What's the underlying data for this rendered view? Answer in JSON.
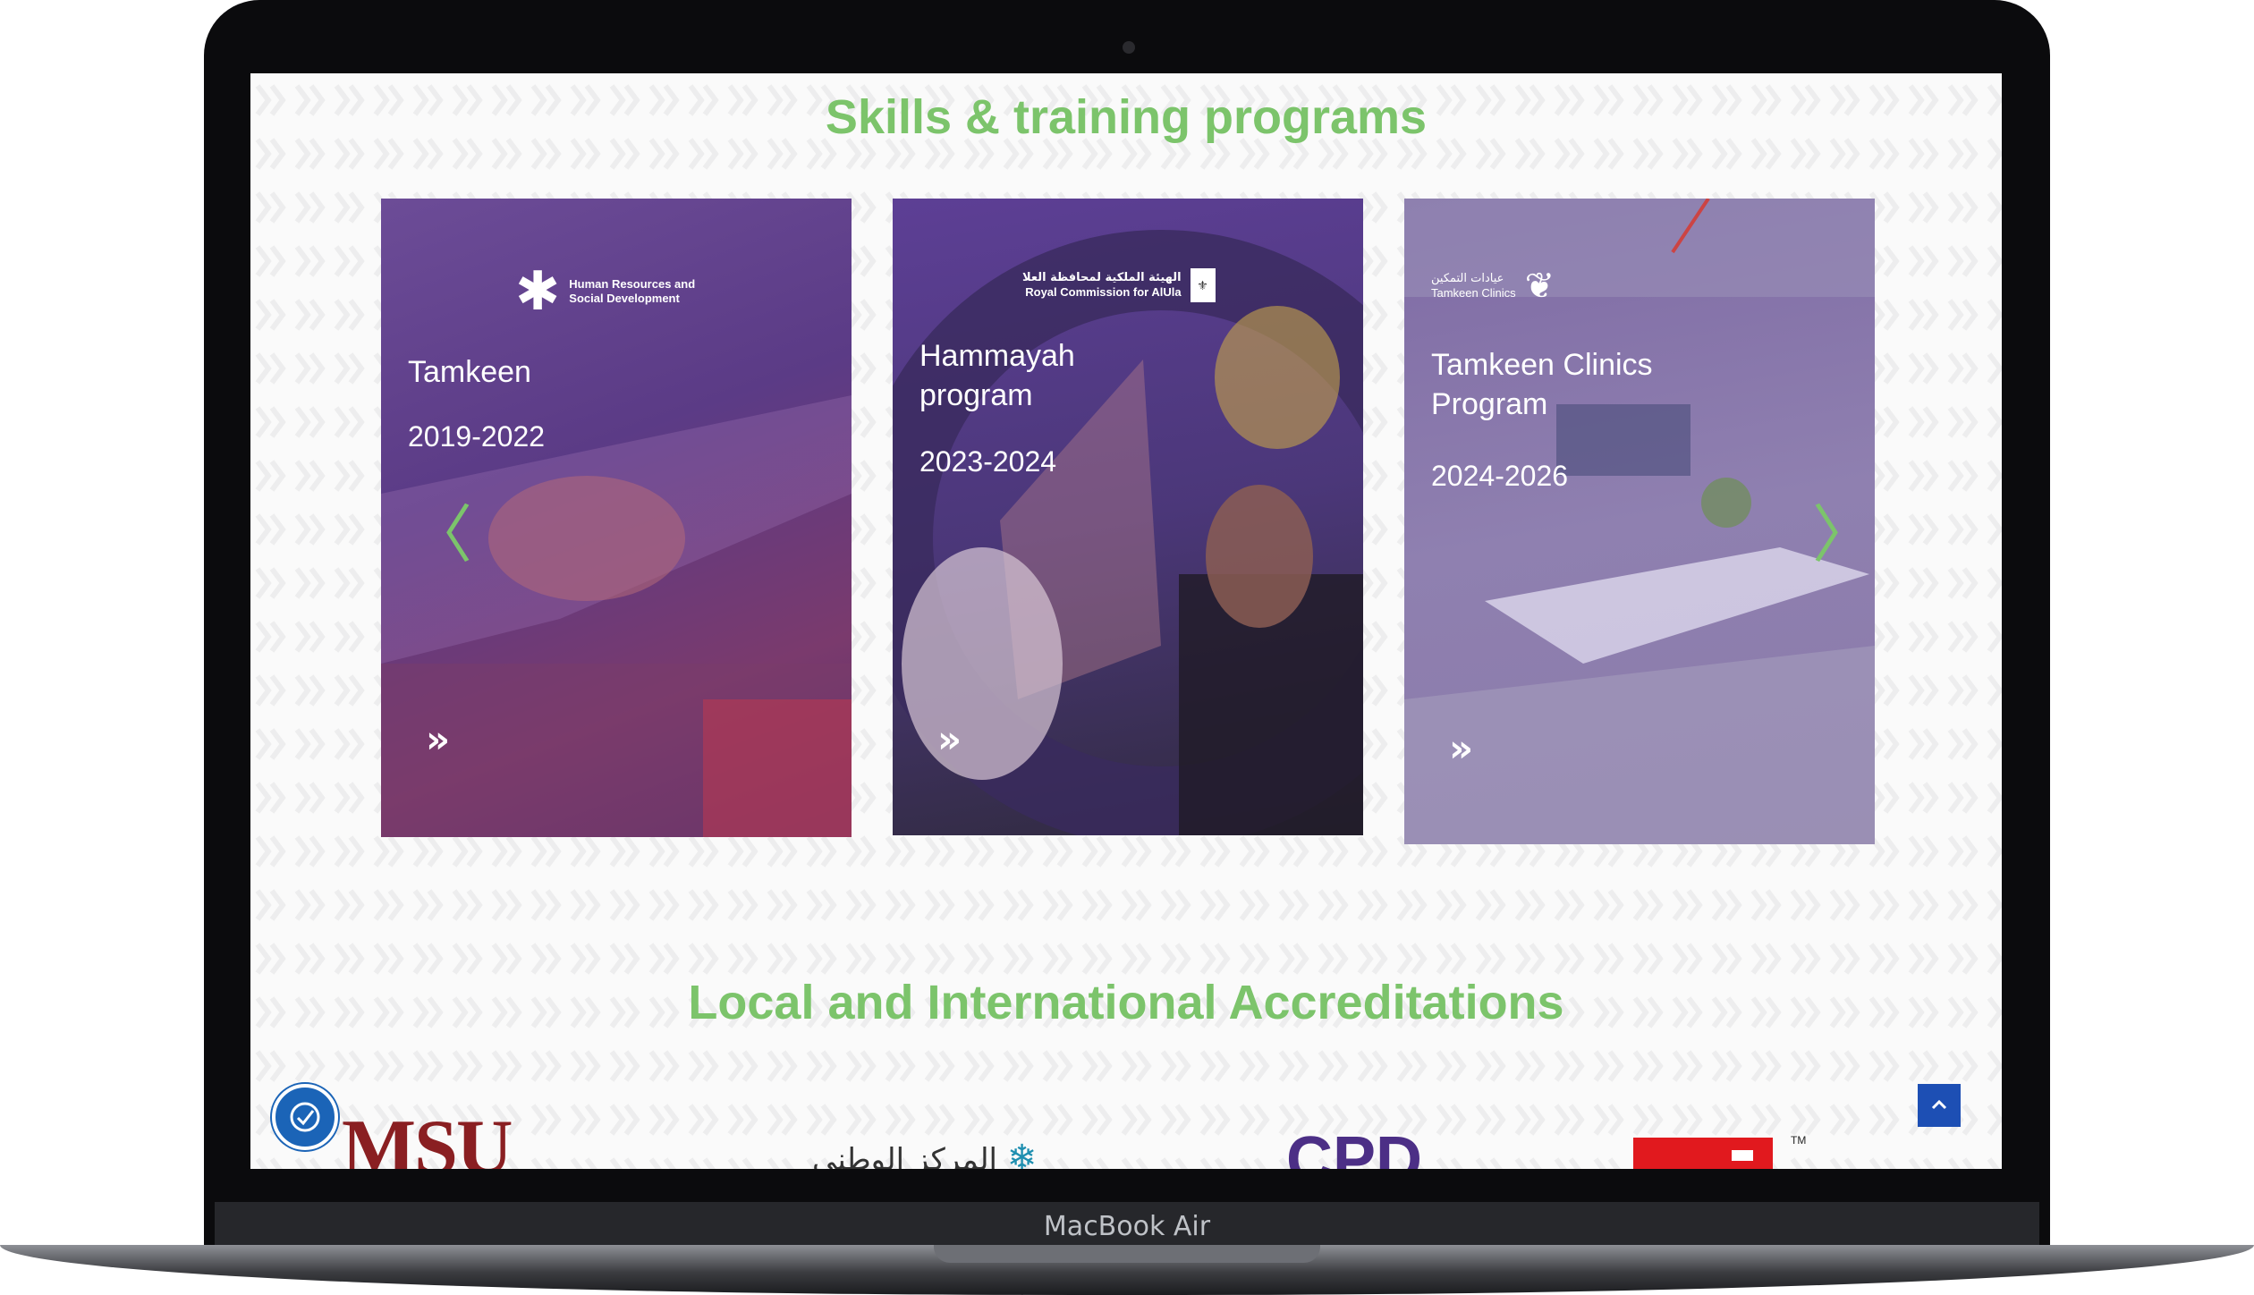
{
  "device": {
    "model_label": "MacBook Air"
  },
  "sections": {
    "skills_title": "Skills & training programs",
    "accreditations_title": "Local and International Accreditations"
  },
  "cards": [
    {
      "title_line1": "Tamkeen",
      "title_line2": "",
      "years": "2019-2022",
      "logo_text": "Human Resources and Social Development"
    },
    {
      "title_line1": "Hammayah",
      "title_line2": "program",
      "years": "2023-2024",
      "logo_text_ar": "الهيئة الملكية لمحافظة العلا",
      "logo_text": "Royal Commission for AlUla"
    },
    {
      "title_line1": "Tamkeen Clinics",
      "title_line2": "Program",
      "years": "2024-2026",
      "logo_text_ar": "عيادات التمكين",
      "logo_text": "Tamkeen Clinics"
    }
  ],
  "card_arrow": "»",
  "carousel": {
    "prev": "〈",
    "next": "〉"
  },
  "accreditations": {
    "msu": "MSU",
    "national_center": "المركز الوطني",
    "cpd": "CPD",
    "tm": "TM"
  },
  "colors": {
    "accent_green": "#7cc46b",
    "card_purple": "#5b3b86",
    "button_blue": "#1d4fb4"
  },
  "icons": {
    "accessibility": "accessibility-icon",
    "scroll_top": "chevron-up-icon"
  }
}
